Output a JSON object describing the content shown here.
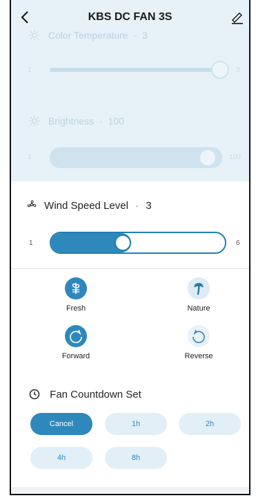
{
  "header": {
    "title": "KBS DC FAN 3S"
  },
  "color_temperature": {
    "label": "Color Temperature",
    "separator": "·",
    "value": "3",
    "min": "1",
    "max": "3"
  },
  "brightness": {
    "label": "Brightness",
    "separator": "·",
    "value": "100",
    "min": "1",
    "max": "100"
  },
  "wind_speed": {
    "label": "Wind Speed Level",
    "separator": "·",
    "value": "3",
    "min": "1",
    "max": "6",
    "level_fraction": 0.4
  },
  "modes": [
    {
      "label": "Fresh",
      "icon": "fresh-icon",
      "active": true
    },
    {
      "label": "Nature",
      "icon": "palm-tree-icon",
      "active": false
    },
    {
      "label": "Forward",
      "icon": "rotate-clockwise-icon",
      "active": true
    },
    {
      "label": "Reverse",
      "icon": "rotate-counterclockwise-icon",
      "active": false
    }
  ],
  "countdown": {
    "label": "Fan Countdown Set",
    "options": [
      "Cancel",
      "1h",
      "2h",
      "4h",
      "8h"
    ],
    "selected": "Cancel"
  },
  "colors": {
    "accent": "#2f88bc",
    "accent_light": "#e3eff7",
    "dimmed": "#e6f1f8"
  }
}
